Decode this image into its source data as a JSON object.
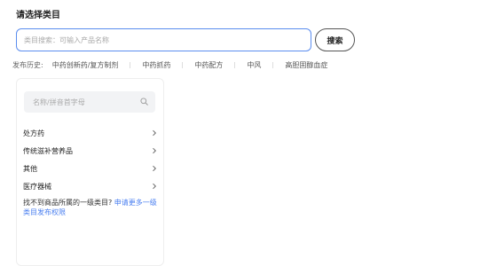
{
  "page": {
    "title": "请选择类目"
  },
  "search": {
    "placeholder": "类目搜索：可输入产品名称",
    "button_label": "搜索"
  },
  "history": {
    "label": "发布历史:",
    "items": [
      "中药创新药/复方制剂",
      "中药抓药",
      "中药配方",
      "中风",
      "高胆固醇血症"
    ]
  },
  "category_panel": {
    "search_placeholder": "名称/拼音首字母",
    "search_icon": "search-icon",
    "items": [
      {
        "label": "处方药"
      },
      {
        "label": "传统滋补营养品"
      },
      {
        "label": "其他"
      },
      {
        "label": "医疗器械"
      }
    ],
    "help_text": "找不到商品所属的一级类目?",
    "help_link": "申请更多一级类目发布权限"
  },
  "colors": {
    "accent": "#5b8def",
    "link": "#4a7ff0",
    "panel_search_bg": "#f2f3f5"
  }
}
